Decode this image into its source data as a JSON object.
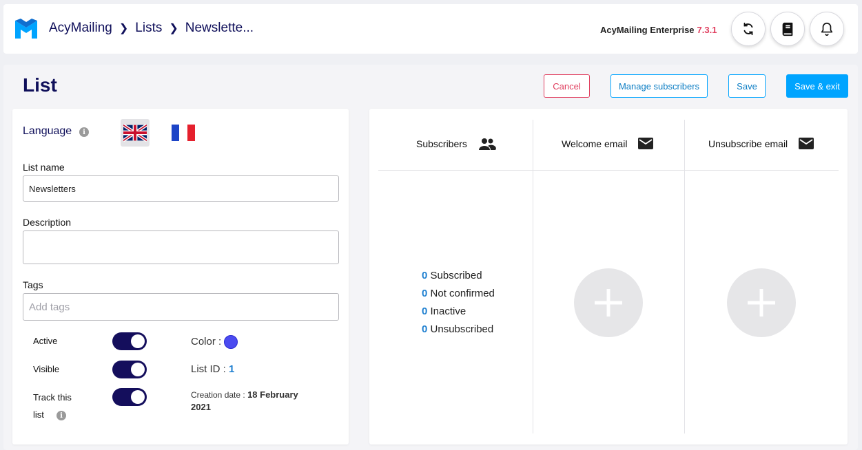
{
  "header": {
    "breadcrumb": [
      "AcyMailing",
      "Lists",
      "Newslette..."
    ],
    "edition": "AcyMailing Enterprise",
    "version": "7.3.1",
    "icons": [
      "refresh-icon",
      "book-icon",
      "bell-icon"
    ]
  },
  "page": {
    "title": "List",
    "buttons": {
      "cancel": "Cancel",
      "manage": "Manage subscribers",
      "save": "Save",
      "save_exit": "Save & exit"
    }
  },
  "form": {
    "language_label": "Language",
    "languages": [
      "English (UK flag)",
      "French (FR flag)"
    ],
    "list_name_label": "List name",
    "list_name_value": "Newsletters",
    "description_label": "Description",
    "description_value": "",
    "tags_label": "Tags",
    "tags_placeholder": "Add tags",
    "active_label": "Active",
    "active": true,
    "visible_label": "Visible",
    "visible": true,
    "track_label_1": "Track this",
    "track_label_2": "list",
    "track": true,
    "color_label": "Color :",
    "color_value": "#4b4bf0",
    "list_id_label": "List ID :",
    "list_id": "1",
    "creation_label": "Creation date :",
    "creation_date_1": "18 February",
    "creation_date_2": "2021"
  },
  "stats": {
    "subscribers_header": "Subscribers",
    "welcome_header": "Welcome email",
    "unsubscribe_header": "Unsubscribe email",
    "rows": [
      {
        "count": "0",
        "label": "Subscribed"
      },
      {
        "count": "0",
        "label": "Not confirmed"
      },
      {
        "count": "0",
        "label": "Inactive"
      },
      {
        "count": "0",
        "label": "Unsubscribed"
      }
    ]
  },
  "colors": {
    "brand": "#00a4ff",
    "navy": "#140e5c",
    "danger": "#e03e5e"
  }
}
